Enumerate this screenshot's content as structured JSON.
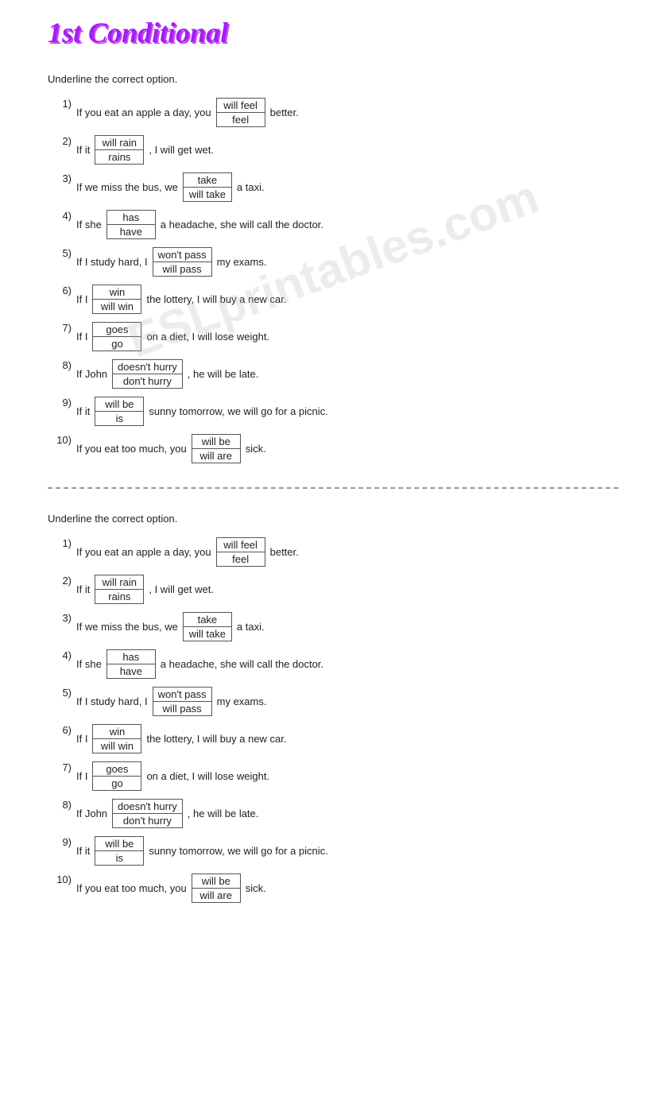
{
  "title": "1st Conditional",
  "watermark": "ESLprintables.com",
  "sections": [
    {
      "instruction": "Underline the correct option.",
      "items": [
        {
          "num": "1)",
          "pre": "If you eat an apple a day, you",
          "choice": {
            "top": "will feel",
            "bottom": "feel"
          },
          "post": "better."
        },
        {
          "num": "2)",
          "pre": "If it",
          "choice": {
            "top": "will rain",
            "bottom": "rains"
          },
          "post": ", I will get wet."
        },
        {
          "num": "3)",
          "pre": "If we miss the bus, we",
          "choice": {
            "top": "take",
            "bottom": "will take"
          },
          "post": "a taxi."
        },
        {
          "num": "4)",
          "pre": "If she",
          "choice": {
            "top": "has",
            "bottom": "have"
          },
          "post": "a headache, she will call the doctor."
        },
        {
          "num": "5)",
          "pre": "If I study hard, I",
          "choice": {
            "top": "won't pass",
            "bottom": "will pass"
          },
          "post": "my exams."
        },
        {
          "num": "6)",
          "pre": "If I",
          "choice": {
            "top": "win",
            "bottom": "will win"
          },
          "post": "the lottery, I will buy a new car."
        },
        {
          "num": "7)",
          "pre": "If I",
          "choice": {
            "top": "goes",
            "bottom": "go"
          },
          "post": "on a diet, I will lose weight."
        },
        {
          "num": "8)",
          "pre": "If John",
          "choice": {
            "top": "doesn't hurry",
            "bottom": "don't hurry"
          },
          "post": ", he will be late."
        },
        {
          "num": "9)",
          "pre": "If it",
          "choice": {
            "top": "will be",
            "bottom": "is"
          },
          "post": "sunny tomorrow, we will go for a picnic."
        },
        {
          "num": "10)",
          "pre": "If you eat too much, you",
          "choice": {
            "top": "will be",
            "bottom": "will are"
          },
          "post": "sick."
        }
      ]
    },
    {
      "instruction": "Underline the correct option.",
      "items": [
        {
          "num": "1)",
          "pre": "If you eat an apple a day, you",
          "choice": {
            "top": "will feel",
            "bottom": "feel"
          },
          "post": "better."
        },
        {
          "num": "2)",
          "pre": "If it",
          "choice": {
            "top": "will rain",
            "bottom": "rains"
          },
          "post": ", I will get wet."
        },
        {
          "num": "3)",
          "pre": "If we miss the bus, we",
          "choice": {
            "top": "take",
            "bottom": "will take"
          },
          "post": "a taxi."
        },
        {
          "num": "4)",
          "pre": "If she",
          "choice": {
            "top": "has",
            "bottom": "have"
          },
          "post": "a headache, she will call the doctor."
        },
        {
          "num": "5)",
          "pre": "If I study hard, I",
          "choice": {
            "top": "won't pass",
            "bottom": "will pass"
          },
          "post": "my exams."
        },
        {
          "num": "6)",
          "pre": "If I",
          "choice": {
            "top": "win",
            "bottom": "will win"
          },
          "post": "the lottery, I will buy a new car."
        },
        {
          "num": "7)",
          "pre": "If I",
          "choice": {
            "top": "goes",
            "bottom": "go"
          },
          "post": "on a diet, I will lose weight."
        },
        {
          "num": "8)",
          "pre": "If John",
          "choice": {
            "top": "doesn't hurry",
            "bottom": "don't hurry"
          },
          "post": ", he will be late."
        },
        {
          "num": "9)",
          "pre": "If it",
          "choice": {
            "top": "will be",
            "bottom": "is"
          },
          "post": "sunny tomorrow, we will go for a picnic."
        },
        {
          "num": "10)",
          "pre": "If you eat too much, you",
          "choice": {
            "top": "will be",
            "bottom": "will are"
          },
          "post": "sick."
        }
      ]
    }
  ]
}
